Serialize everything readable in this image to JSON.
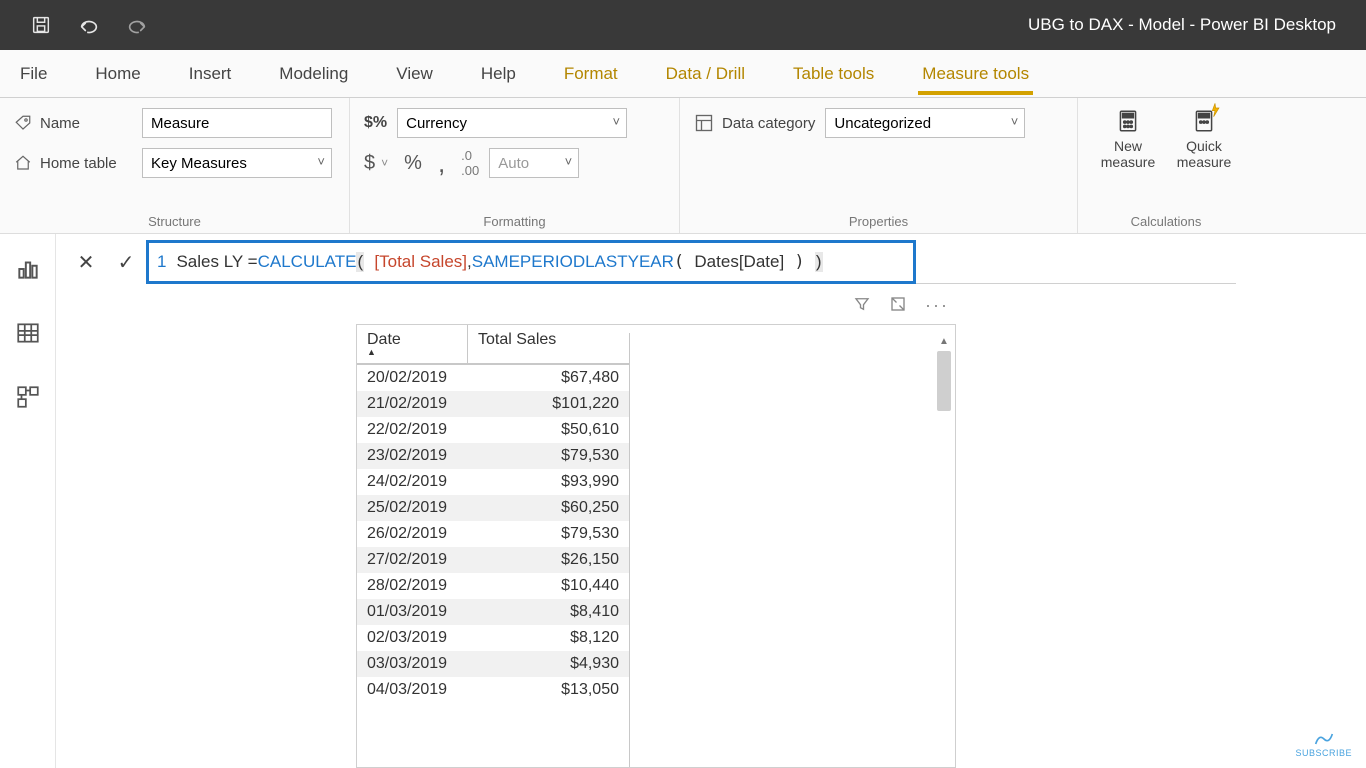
{
  "titlebar": {
    "title": "UBG to DAX - Model - Power BI Desktop"
  },
  "tabs": {
    "file": "File",
    "home": "Home",
    "insert": "Insert",
    "modeling": "Modeling",
    "view": "View",
    "help": "Help",
    "format": "Format",
    "datadrill": "Data / Drill",
    "tabletools": "Table tools",
    "measuretools": "Measure tools"
  },
  "ribbon": {
    "structure": {
      "caption": "Structure",
      "name_label": "Name",
      "name_value": "Measure",
      "home_label": "Home table",
      "home_value": "Key Measures"
    },
    "formatting": {
      "caption": "Formatting",
      "format_value": "Currency",
      "decimals_value": "Auto",
      "dollar": "$",
      "pct": "%",
      "comma": ",",
      "dec": ".00"
    },
    "properties": {
      "caption": "Properties",
      "cat_label": "Data category",
      "cat_value": "Uncategorized"
    },
    "calculations": {
      "caption": "Calculations",
      "new": "New\nmeasure",
      "quick": "Quick\nmeasure"
    }
  },
  "formula": {
    "line": "1",
    "left": "Sales LY = ",
    "calc": "CALCULATE",
    "meas": "[Total Sales]",
    "sep": ", ",
    "fn2": "SAMEPERIODLASTYEAR",
    "col": "Dates[Date]"
  },
  "visual": {
    "cols": {
      "date": "Date",
      "total": "Total Sales"
    }
  },
  "chart_data": {
    "type": "table",
    "columns": [
      "Date",
      "Total Sales"
    ],
    "rows": [
      [
        "20/02/2019",
        "$67,480"
      ],
      [
        "21/02/2019",
        "$101,220"
      ],
      [
        "22/02/2019",
        "$50,610"
      ],
      [
        "23/02/2019",
        "$79,530"
      ],
      [
        "24/02/2019",
        "$93,990"
      ],
      [
        "25/02/2019",
        "$60,250"
      ],
      [
        "26/02/2019",
        "$79,530"
      ],
      [
        "27/02/2019",
        "$26,150"
      ],
      [
        "28/02/2019",
        "$10,440"
      ],
      [
        "01/03/2019",
        "$8,410"
      ],
      [
        "02/03/2019",
        "$8,120"
      ],
      [
        "03/03/2019",
        "$4,930"
      ],
      [
        "04/03/2019",
        "$13,050"
      ]
    ]
  },
  "badge": "SUBSCRIBE"
}
